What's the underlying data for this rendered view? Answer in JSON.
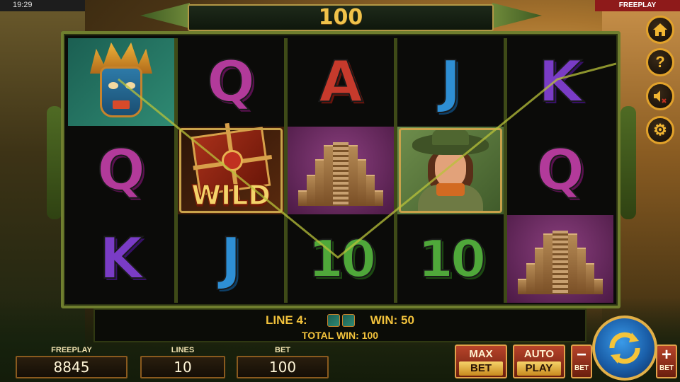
{
  "status": {
    "time": "19:29",
    "mode": "FREEPLAY"
  },
  "credits_display": "100",
  "reels": [
    [
      "mask",
      "Q",
      "K"
    ],
    [
      "Q",
      "wild",
      "J"
    ],
    [
      "A",
      "pyramid",
      "10"
    ],
    [
      "J",
      "explorer",
      "10"
    ],
    [
      "K",
      "Q",
      "pyramid"
    ]
  ],
  "wild_text": "WILD",
  "win_info": {
    "line_label": "LINE 4:",
    "win_label": "WIN: 50",
    "total_label": "TOTAL WIN: 100"
  },
  "stats": {
    "freeplay": {
      "label": "FREEPLAY",
      "value": "8845"
    },
    "lines": {
      "label": "LINES",
      "value": "10"
    },
    "bet": {
      "label": "BET",
      "value": "100"
    }
  },
  "buttons": {
    "max_bet": {
      "line1": "MAX",
      "line2": "BET"
    },
    "auto_play": {
      "line1": "AUTO",
      "line2": "PLAY"
    },
    "bet_minus": {
      "symbol": "−",
      "label": "BET"
    },
    "bet_plus": {
      "symbol": "+",
      "label": "BET"
    }
  },
  "side_buttons": [
    "home-icon",
    "help-icon",
    "sound-muted-icon",
    "settings-gear-icon"
  ],
  "colors": {
    "accent_gold": "#f2c23c",
    "frame_green": "#6f7e2e",
    "spin_blue": "#1a5ea8"
  }
}
